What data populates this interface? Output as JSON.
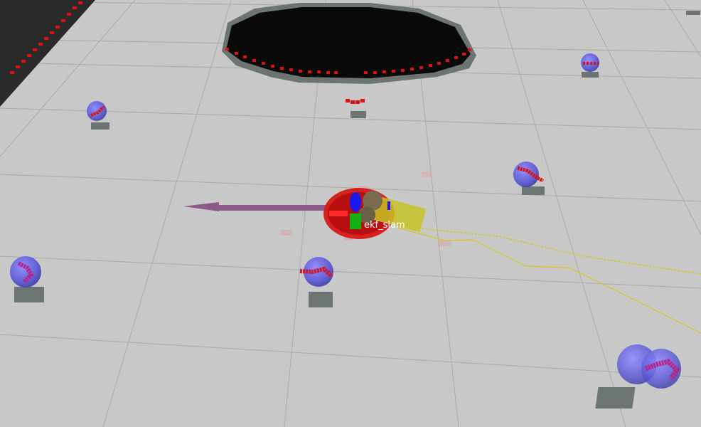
{
  "scene": {
    "colors": {
      "floor": "#c8c8c8",
      "grid_line": "#a9a9a9",
      "occupied_cell": "#0a0a0a",
      "scan_points": "#e01010",
      "landmark_sphere": "#6f6cf2",
      "landmark_marker": "#485a58",
      "path": "#d6c61e",
      "heading_arrow": "#8a5a8a",
      "robot_body": "#c8c226"
    },
    "robot_label": "ekf_slam"
  }
}
